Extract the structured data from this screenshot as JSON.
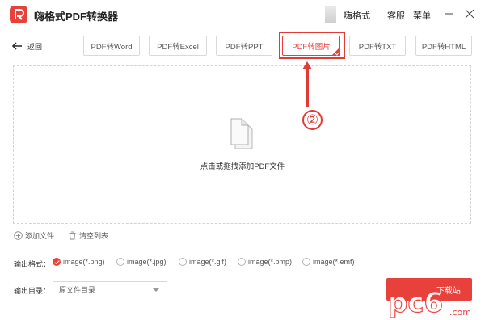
{
  "app": {
    "title": "嗨格式PDF转换器"
  },
  "header": {
    "user_name": "嗨格式",
    "service_label": "客服",
    "menu_label": "菜单"
  },
  "nav": {
    "back_label": "返回"
  },
  "tabs": [
    {
      "label": "PDF转Word",
      "active": false
    },
    {
      "label": "PDF转Excel",
      "active": false
    },
    {
      "label": "PDF转PPT",
      "active": false
    },
    {
      "label": "PDF转图片",
      "active": true
    },
    {
      "label": "PDF转TXT",
      "active": false
    },
    {
      "label": "PDF转HTML",
      "active": false
    }
  ],
  "annotation": {
    "step_number": "②"
  },
  "dropzone": {
    "hint": "点击或拖拽添加PDF文件"
  },
  "file_actions": {
    "add_label": "添加文件",
    "clear_label": "清空列表"
  },
  "output_format": {
    "label": "输出格式：",
    "options": [
      {
        "label": "image(*.png)",
        "selected": true
      },
      {
        "label": "image(*.jpg)",
        "selected": false
      },
      {
        "label": "image(*.gif)",
        "selected": false
      },
      {
        "label": "image(*.bmp)",
        "selected": false
      },
      {
        "label": "image(*.emf)",
        "selected": false
      }
    ]
  },
  "output_dir": {
    "label": "输出目录：",
    "value": "原文件目录"
  },
  "watermark": {
    "text": "pc6",
    "sub": "下载站",
    "domain": ".com"
  },
  "colors": {
    "accent": "#e8413c",
    "annotation": "#e23b35",
    "border": "#d9d9d9"
  }
}
